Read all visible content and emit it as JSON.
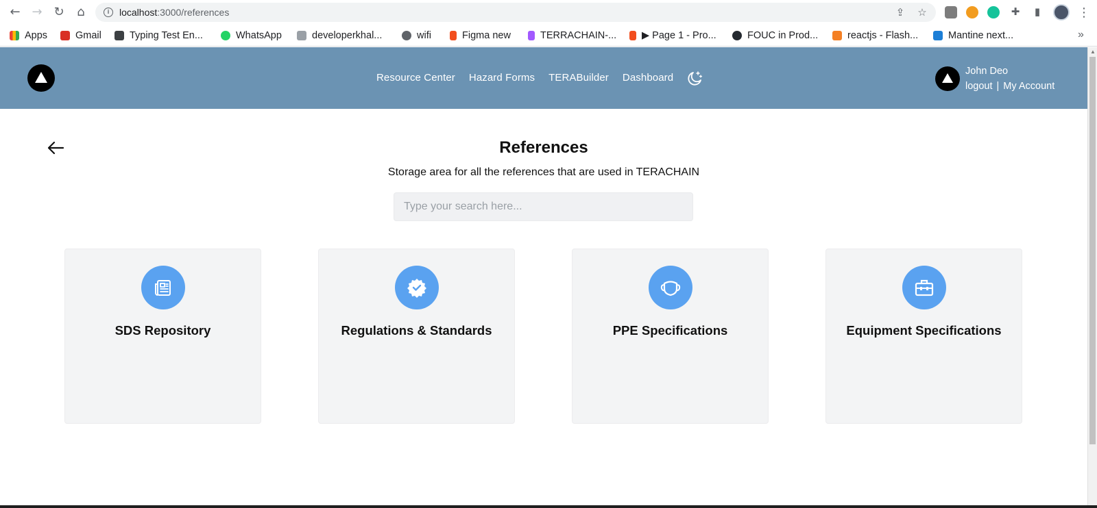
{
  "browser": {
    "url_host": "localhost",
    "url_path": ":3000/references",
    "bookmarks": [
      {
        "label": "Apps",
        "color": "#ea4335"
      },
      {
        "label": "Gmail",
        "color": "#d93025"
      },
      {
        "label": "Typing Test En...",
        "color": "#3c4043"
      },
      {
        "label": "WhatsApp",
        "color": "#25d366"
      },
      {
        "label": "developerkhal...",
        "color": "#9aa0a6"
      },
      {
        "label": "wifi",
        "color": "#5f6368"
      },
      {
        "label": "Figma new",
        "color": "#f24e1e"
      },
      {
        "label": "TERRACHAIN-...",
        "color": "#a259ff"
      },
      {
        "label": "▶ Page 1 - Pro...",
        "color": "#f24e1e"
      },
      {
        "label": "FOUC in Prod...",
        "color": "#24292f"
      },
      {
        "label": "reactjs - Flash...",
        "color": "#f48024"
      },
      {
        "label": "Mantine next...",
        "color": "#1c7ed6"
      }
    ],
    "more_bookmarks": "»"
  },
  "header": {
    "nav": [
      "Resource Center",
      "Hazard Forms",
      "TERABuilder",
      "Dashboard"
    ],
    "user_name": "John Deo",
    "logout": "logout",
    "separator": "|",
    "my_account": "My Account",
    "bg_color": "#6b93b3"
  },
  "page": {
    "title": "References",
    "subtitle": "Storage area for all the references that are used in TERACHAIN",
    "search_placeholder": "Type your search here..."
  },
  "cards": [
    {
      "title": "SDS Repository",
      "icon": "newspaper-icon"
    },
    {
      "title": "Regulations & Standards",
      "icon": "verified-badge-icon"
    },
    {
      "title": "PPE Specifications",
      "icon": "face-mask-icon"
    },
    {
      "title": "Equipment Specifications",
      "icon": "toolbox-icon"
    }
  ]
}
